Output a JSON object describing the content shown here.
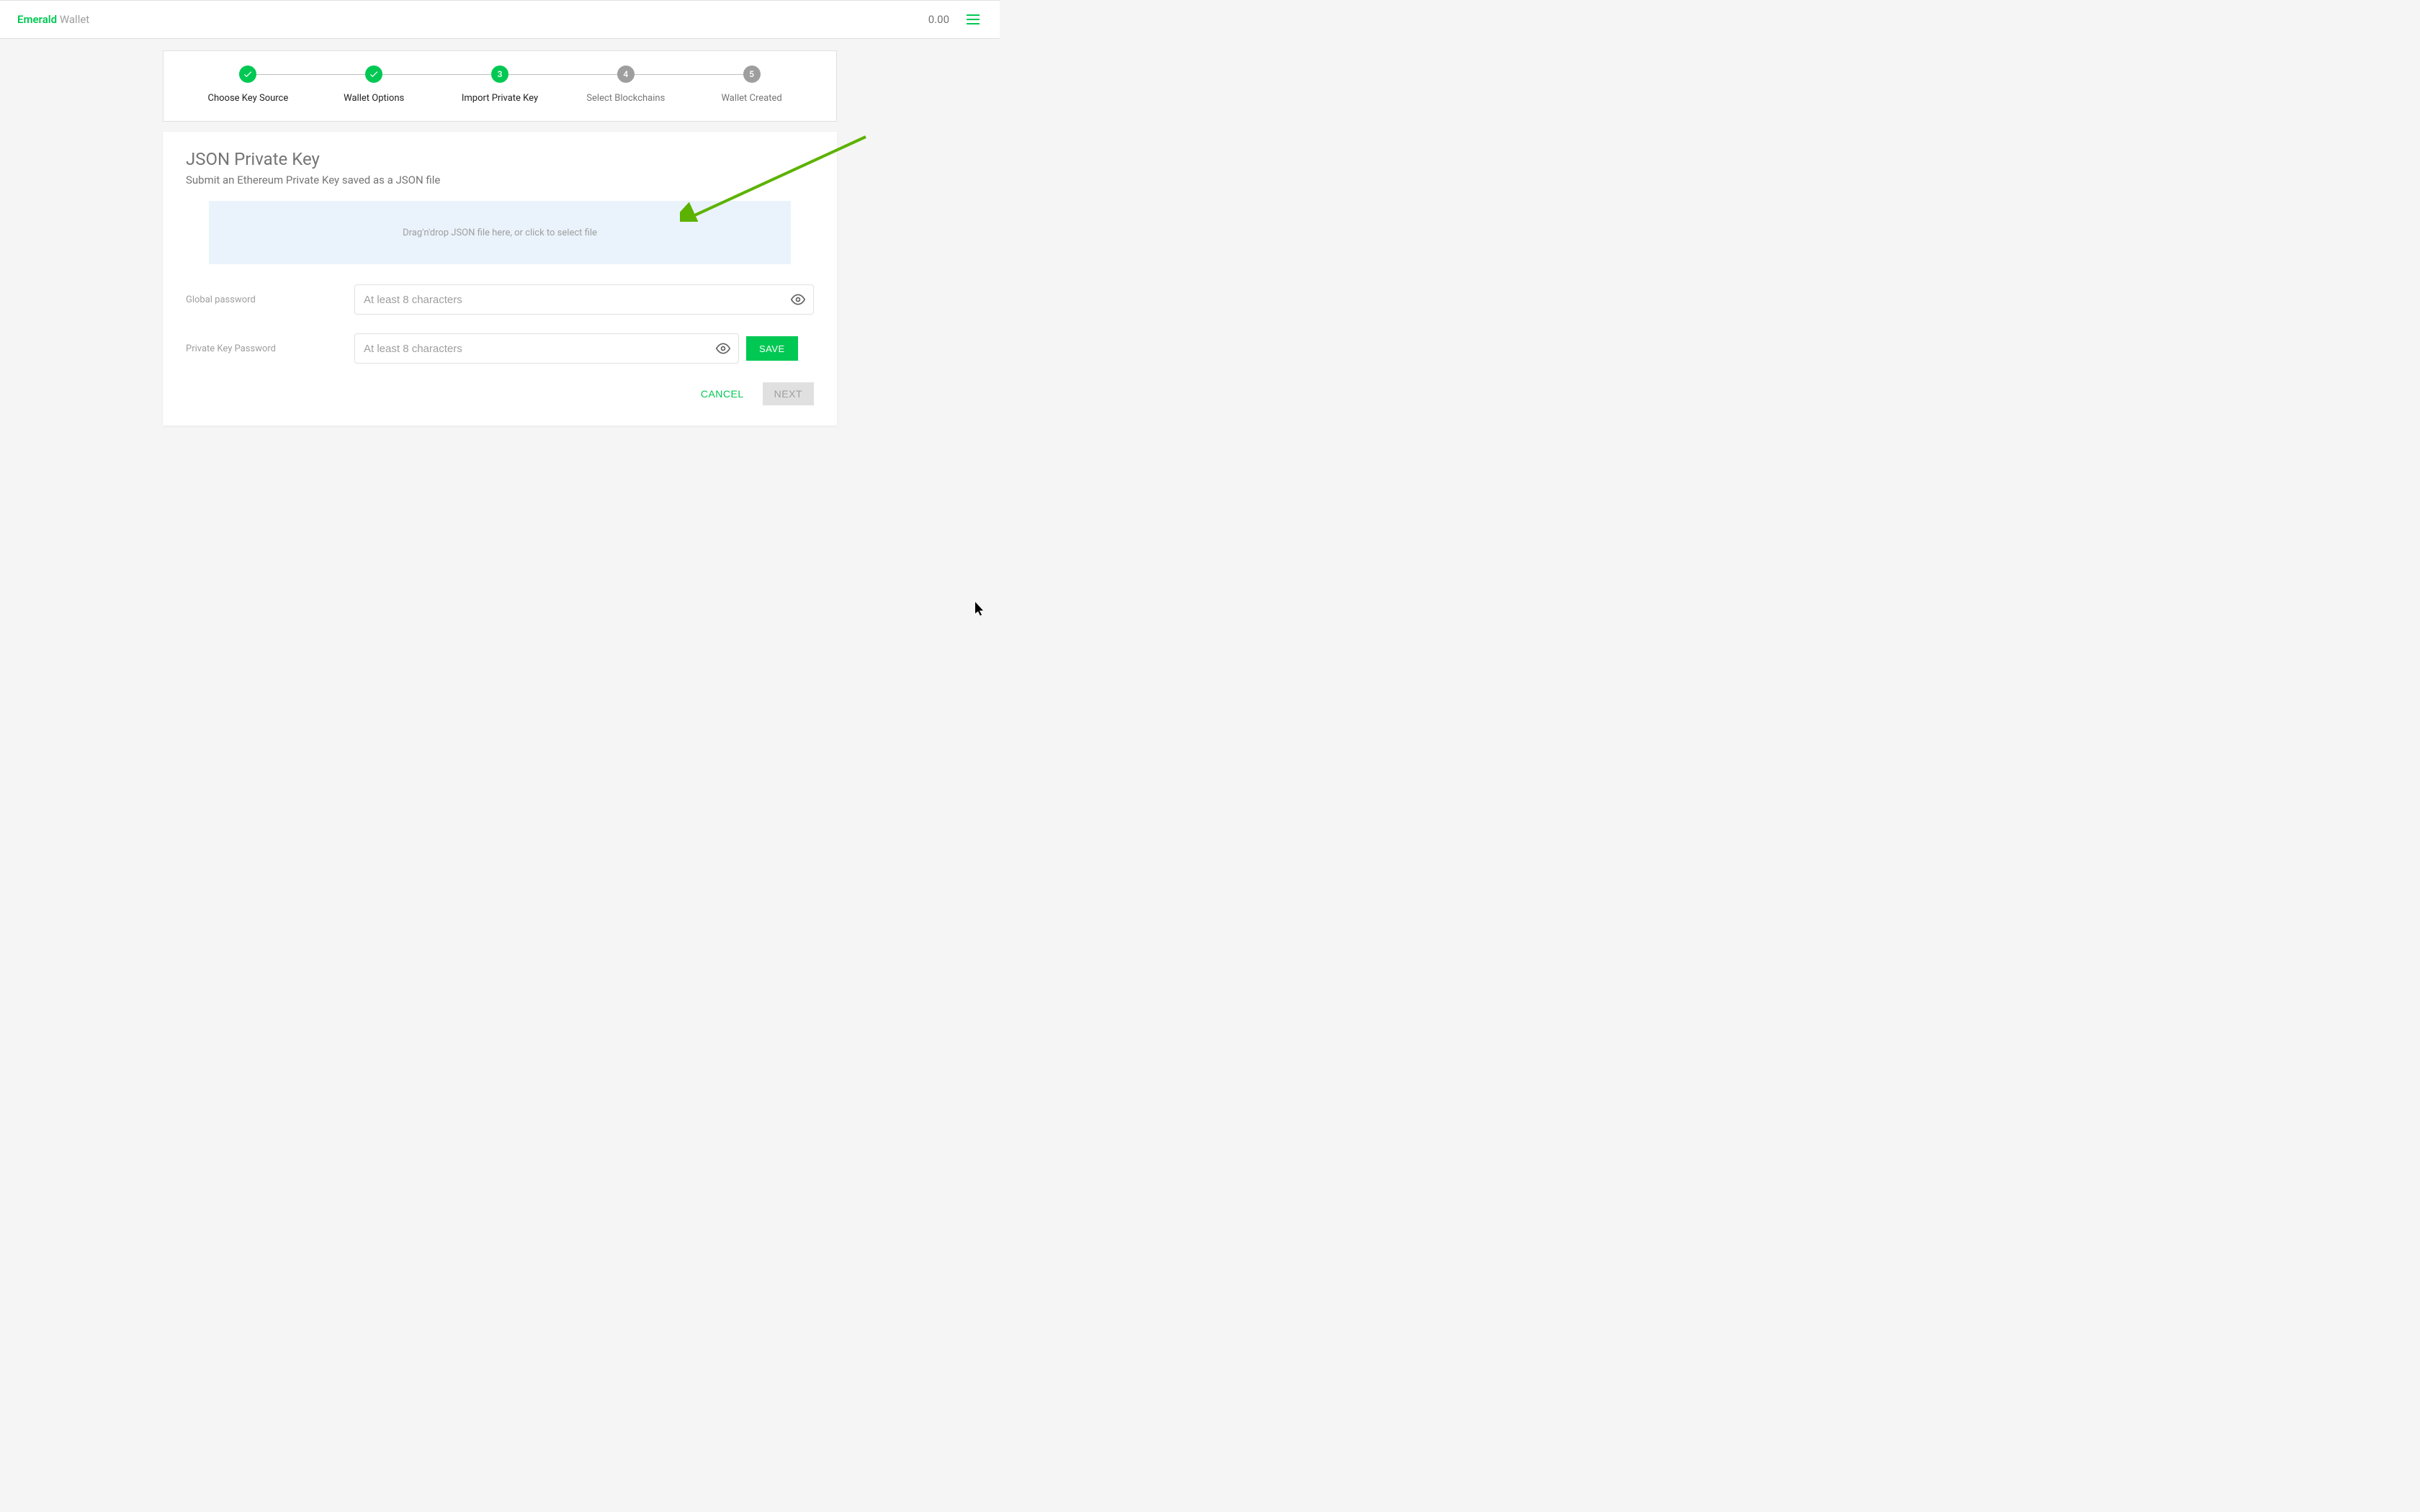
{
  "header": {
    "brand_primary": "Emerald",
    "brand_secondary": " Wallet",
    "balance": "0.00"
  },
  "stepper": {
    "steps": [
      {
        "label": "Choose Key Source",
        "state": "done",
        "indicator": "✓"
      },
      {
        "label": "Wallet Options",
        "state": "done",
        "indicator": "✓"
      },
      {
        "label": "Import Private Key",
        "state": "active",
        "indicator": "3"
      },
      {
        "label": "Select Blockchains",
        "state": "pending",
        "indicator": "4"
      },
      {
        "label": "Wallet Created",
        "state": "pending",
        "indicator": "5"
      }
    ]
  },
  "page": {
    "title": "JSON Private Key",
    "subtitle": "Submit an Ethereum Private Key saved as a JSON file"
  },
  "dropzone": {
    "text": "Drag'n'drop JSON file here, or click to select file"
  },
  "form": {
    "global_password_label": "Global password",
    "global_password_placeholder": "At least 8 characters",
    "private_key_password_label": "Private Key Password",
    "private_key_password_placeholder": "At least 8 characters",
    "save_label": "SAVE"
  },
  "actions": {
    "cancel": "CANCEL",
    "next": "NEXT"
  }
}
